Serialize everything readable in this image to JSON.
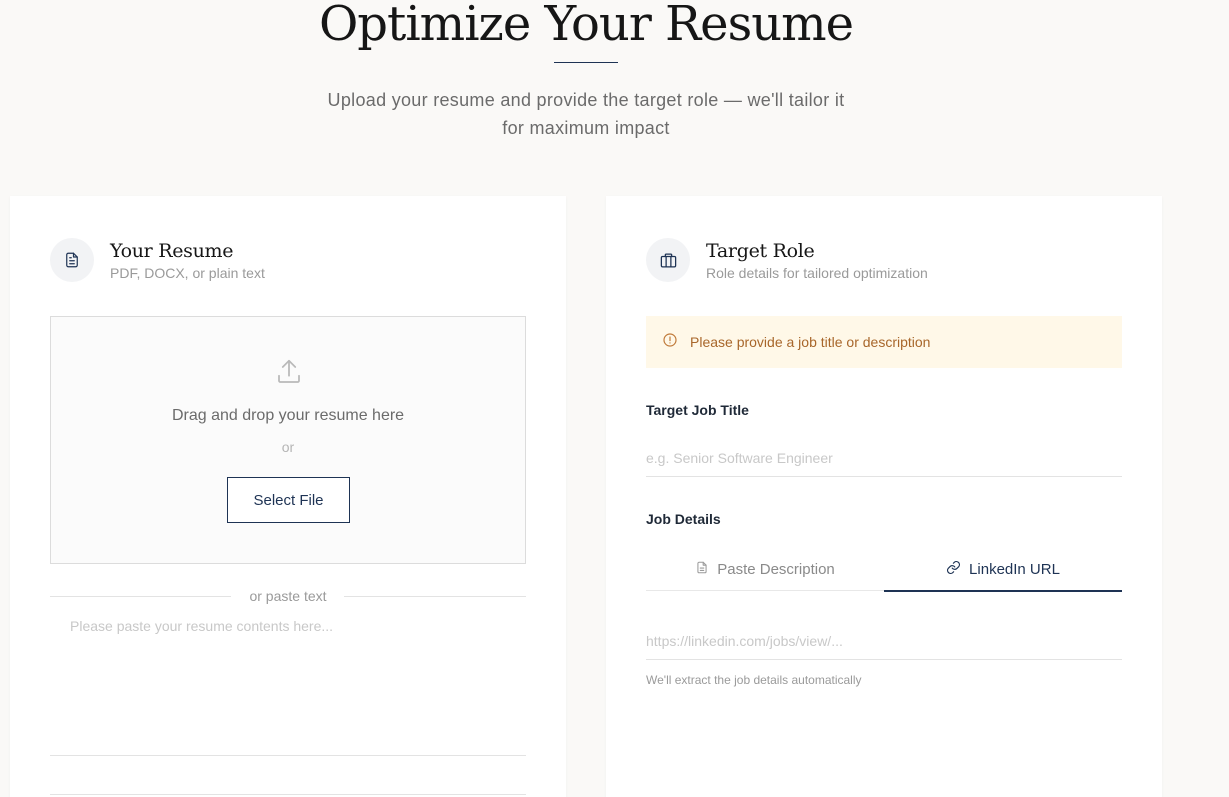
{
  "hero": {
    "title": "Optimize Your Resume",
    "subtitle_line1": "Upload your resume and provide the target role — we'll tailor it",
    "subtitle_line2": "for maximum impact"
  },
  "resume_card": {
    "title": "Your Resume",
    "subtitle": "PDF, DOCX, or plain text",
    "icon": "document-icon",
    "dropzone": {
      "icon": "upload-icon",
      "text": "Drag and drop your resume here",
      "or": "or",
      "button_label": "Select File"
    },
    "divider_text": "or paste text",
    "paste_placeholder": "Please paste your resume contents here..."
  },
  "role_card": {
    "title": "Target Role",
    "subtitle": "Role details for tailored optimization",
    "icon": "briefcase-icon",
    "alert": {
      "icon": "alert-circle-icon",
      "text": "Please provide a job title or description"
    },
    "job_title": {
      "label": "Target Job Title",
      "placeholder": "e.g. Senior Software Engineer",
      "value": ""
    },
    "job_details": {
      "label": "Job Details",
      "tabs": [
        {
          "label": "Paste Description",
          "icon": "file-text-icon",
          "active": false
        },
        {
          "label": "LinkedIn URL",
          "icon": "link-icon",
          "active": true
        }
      ],
      "url_placeholder": "https://linkedin.com/jobs/view/...",
      "helper": "We'll extract the job details automatically"
    }
  },
  "colors": {
    "background": "#faf9f7",
    "accent_navy": "#1e3354",
    "alert_bg": "#fff8e8",
    "alert_text": "#a8662a"
  }
}
